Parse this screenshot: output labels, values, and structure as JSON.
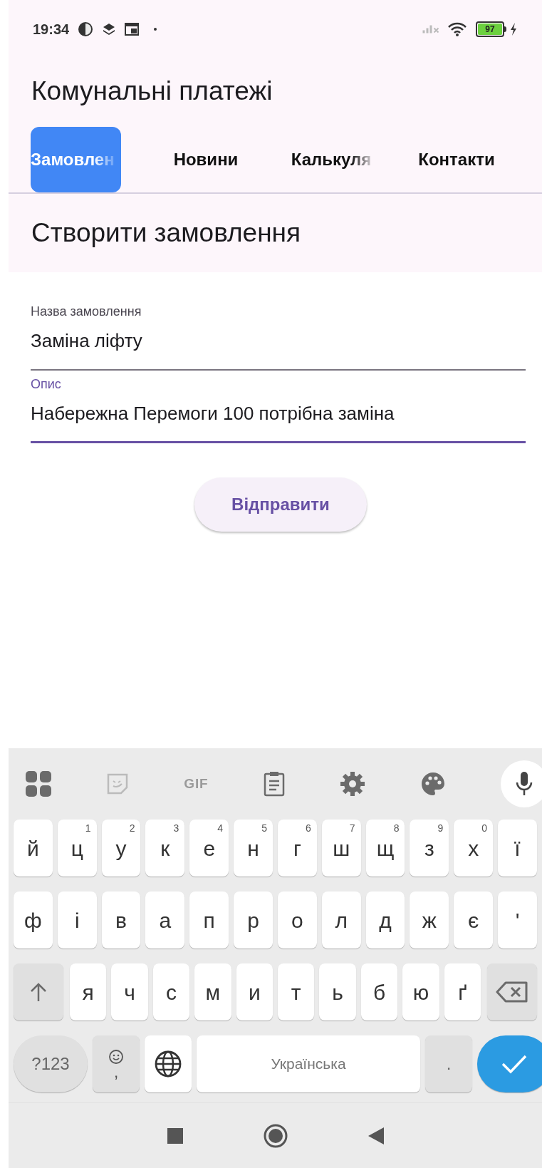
{
  "status_bar": {
    "time": "19:34",
    "battery": "97"
  },
  "app_bar": {
    "title": "Комунальні платежі"
  },
  "tabs": [
    {
      "label": "Замовлен",
      "selected": true,
      "faded": true
    },
    {
      "label": "Новини",
      "selected": false,
      "faded": false
    },
    {
      "label": "Калькуля",
      "selected": false,
      "faded": true
    },
    {
      "label": "Контакти",
      "selected": false,
      "faded": false
    }
  ],
  "section_title": "Створити замовлення",
  "fields": [
    {
      "label": "Назва замовлення",
      "value": "Заміна ліфту",
      "focused": false
    },
    {
      "label": "Опис",
      "value": "Набережна Перемоги 100 потрібна заміна",
      "focused": true
    }
  ],
  "submit_button": "Відправити",
  "keyboard": {
    "toolbar": {
      "gif": "GIF"
    },
    "rows": [
      [
        {
          "kind": "letter",
          "label": "й"
        },
        {
          "kind": "letter",
          "label": "ц",
          "hint": "1"
        },
        {
          "kind": "letter",
          "label": "у",
          "hint": "2"
        },
        {
          "kind": "letter",
          "label": "к",
          "hint": "3"
        },
        {
          "kind": "letter",
          "label": "е",
          "hint": "4"
        },
        {
          "kind": "letter",
          "label": "н",
          "hint": "5"
        },
        {
          "kind": "letter",
          "label": "г",
          "hint": "6"
        },
        {
          "kind": "letter",
          "label": "ш",
          "hint": "7"
        },
        {
          "kind": "letter",
          "label": "щ",
          "hint": "8"
        },
        {
          "kind": "letter",
          "label": "з",
          "hint": "9"
        },
        {
          "kind": "letter",
          "label": "х",
          "hint": "0"
        },
        {
          "kind": "letter",
          "label": "ї"
        }
      ],
      [
        {
          "kind": "letter",
          "label": "ф"
        },
        {
          "kind": "letter",
          "label": "і"
        },
        {
          "kind": "letter",
          "label": "в"
        },
        {
          "kind": "letter",
          "label": "а"
        },
        {
          "kind": "letter",
          "label": "п"
        },
        {
          "kind": "letter",
          "label": "р"
        },
        {
          "kind": "letter",
          "label": "о"
        },
        {
          "kind": "letter",
          "label": "л"
        },
        {
          "kind": "letter",
          "label": "д"
        },
        {
          "kind": "letter",
          "label": "ж"
        },
        {
          "kind": "letter",
          "label": "є"
        },
        {
          "kind": "letter",
          "label": "'"
        }
      ],
      [
        {
          "kind": "shift"
        },
        {
          "kind": "letter",
          "label": "я"
        },
        {
          "kind": "letter",
          "label": "ч"
        },
        {
          "kind": "letter",
          "label": "с"
        },
        {
          "kind": "letter",
          "label": "м"
        },
        {
          "kind": "letter",
          "label": "и"
        },
        {
          "kind": "letter",
          "label": "т"
        },
        {
          "kind": "letter",
          "label": "ь"
        },
        {
          "kind": "letter",
          "label": "б"
        },
        {
          "kind": "letter",
          "label": "ю"
        },
        {
          "kind": "letter",
          "label": "ґ"
        },
        {
          "kind": "backspace"
        }
      ]
    ],
    "bottom_row": {
      "symbols": "?123",
      "comma": ",",
      "space": "Українська",
      "period": "."
    }
  }
}
